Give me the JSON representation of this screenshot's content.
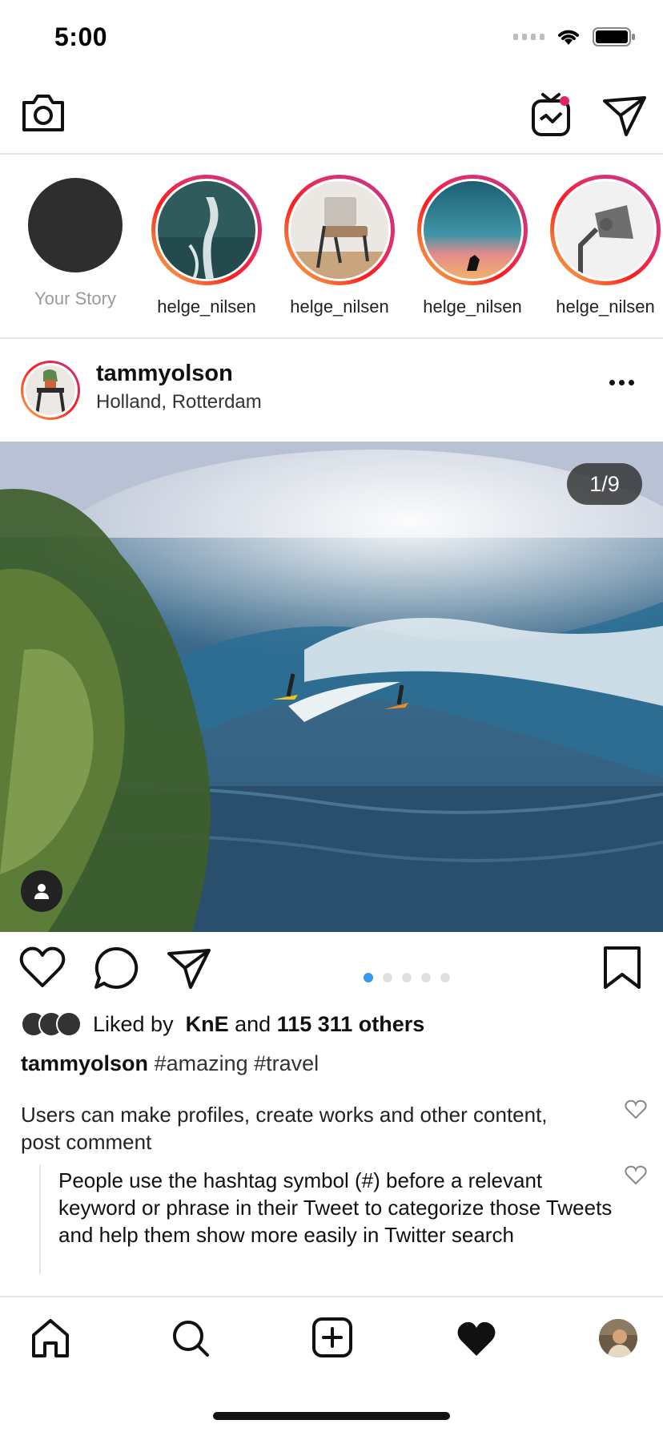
{
  "status_bar": {
    "time": "5:00"
  },
  "stories": [
    {
      "label": "Your Story",
      "own": true
    },
    {
      "label": "helge_nilsen"
    },
    {
      "label": "helge_nilsen"
    },
    {
      "label": "helge_nilsen"
    },
    {
      "label": "helge_nilsen"
    }
  ],
  "post": {
    "author": "tammyolson",
    "location": "Holland, Rotterdam",
    "counter": "1/9",
    "page_dots": {
      "total": 5,
      "active": 1
    },
    "likes": {
      "prefix": "Liked by",
      "user": "KnE",
      "and": "and",
      "others": "115 311 others"
    },
    "caption": {
      "author": "tammyolson",
      "text": "#amazing #travel"
    },
    "comments": [
      {
        "text": "Users can make profiles, create works and other content, post comment"
      },
      {
        "text": "People use the hashtag symbol (#) before a relevant keyword or phrase in their Tweet to categorize those Tweets and help them show more easily in Twitter search",
        "reply": true
      }
    ]
  },
  "colors": {
    "accent": "#3897f0",
    "notification": "#e0245e"
  },
  "icons": [
    "camera-icon",
    "igtv-icon",
    "direct-message-icon",
    "more-icon",
    "tag-user-icon",
    "heart-icon",
    "comment-icon",
    "share-icon",
    "bookmark-icon",
    "home-icon",
    "search-icon",
    "new-post-icon",
    "activity-icon",
    "profile-avatar"
  ]
}
